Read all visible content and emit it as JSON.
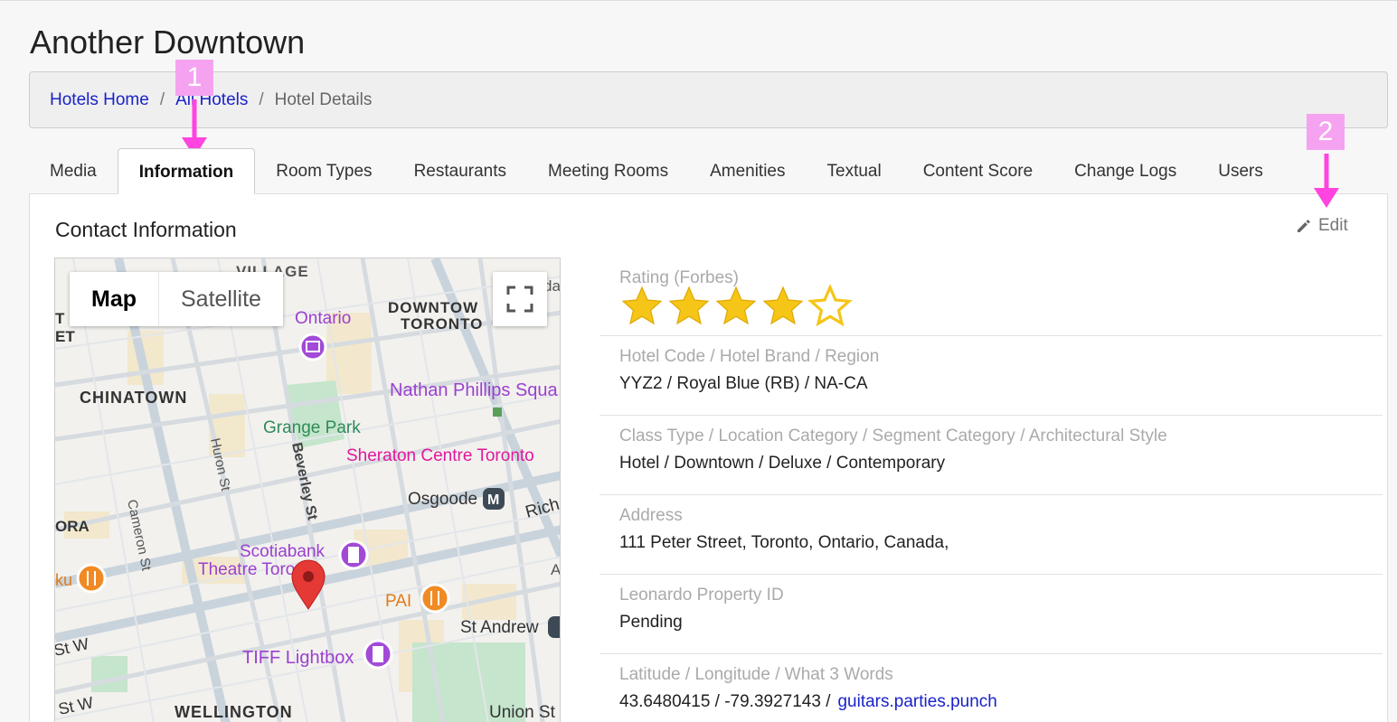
{
  "page_title": "Another Downtown",
  "breadcrumb": {
    "home": "Hotels Home",
    "all": "All Hotels",
    "current": "Hotel Details",
    "sep": "/"
  },
  "tabs": [
    {
      "label": "Media",
      "active": false
    },
    {
      "label": "Information",
      "active": true
    },
    {
      "label": "Room Types",
      "active": false
    },
    {
      "label": "Restaurants",
      "active": false
    },
    {
      "label": "Meeting Rooms",
      "active": false
    },
    {
      "label": "Amenities",
      "active": false
    },
    {
      "label": "Textual",
      "active": false
    },
    {
      "label": "Content Score",
      "active": false
    },
    {
      "label": "Change Logs",
      "active": false
    },
    {
      "label": "Users",
      "active": false
    }
  ],
  "section": {
    "title": "Contact Information",
    "edit_label": "Edit"
  },
  "map": {
    "toggle": {
      "map": "Map",
      "satellite": "Satellite"
    },
    "labels": {
      "village": "VILLAGE",
      "downtown": "DOWNTOW",
      "toronto": "TORONTO",
      "ontario": "Ontario",
      "chinatown": "CHINATOWN",
      "nathan": "Nathan Phillips Squa",
      "grange": "Grange Park",
      "sheraton": "Sheraton Centre Toronto",
      "huron": "Huron St",
      "beverley": "Beverley St",
      "osgoode": "Osgoode",
      "rich": "Rich",
      "ora": "ORA",
      "cameron": "Cameron St",
      "scotiabank1": "Scotiabank",
      "scotiabank2": "Theatre Toronto",
      "ku": "ku",
      "pai": "PAI",
      "standrew": "St Andrew",
      "stw1": "St W",
      "tiff": "TIFF Lightbox",
      "stw2": "St W",
      "wellington": "WELLINGTON",
      "union": "Union St",
      "to": "T",
      "et": "ET",
      "da": "da",
      "a": "A",
      "m": "M"
    }
  },
  "rating": {
    "label": "Rating (Forbes)",
    "value": 4,
    "max": 5
  },
  "fields": [
    {
      "label": "Hotel Code / Hotel Brand / Region",
      "value": "YYZ2 / Royal Blue (RB) / NA-CA"
    },
    {
      "label": "Class Type / Location Category / Segment Category / Architectural Style",
      "value": "Hotel / Downtown / Deluxe / Contemporary"
    },
    {
      "label": "Address",
      "value": "111 Peter Street, Toronto, Ontario, Canada,"
    },
    {
      "label": "Leonardo Property ID",
      "value": "Pending"
    },
    {
      "label": "Latitude / Longitude / What 3 Words",
      "value": "43.6480415 / -79.3927143 /",
      "link": "guitars.parties.punch"
    }
  ],
  "annotations": {
    "one": "1",
    "two": "2"
  },
  "colors": {
    "link": "#1a22c9",
    "star": "#f5c518",
    "annotation": "#f5a3f0",
    "pin": "#e53935"
  }
}
